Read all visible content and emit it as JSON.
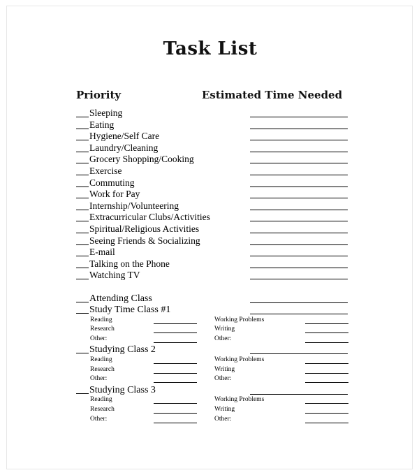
{
  "document": {
    "title": "Task List",
    "headers": {
      "priority": "Priority",
      "estimated_time": "Estimated Time Needed"
    },
    "blank_prefix": "___"
  },
  "tasks": [
    {
      "label": "Sleeping",
      "has_time_line": true
    },
    {
      "label": "Eating",
      "has_time_line": true
    },
    {
      "label": "Hygiene/Self Care",
      "has_time_line": true
    },
    {
      "label": "Laundry/Cleaning",
      "has_time_line": true
    },
    {
      "label": "Grocery Shopping/Cooking",
      "has_time_line": true
    },
    {
      "label": "Exercise",
      "has_time_line": true
    },
    {
      "label": "Commuting",
      "has_time_line": true
    },
    {
      "label": "Work for Pay",
      "has_time_line": true
    },
    {
      "label": "Internship/Volunteering",
      "has_time_line": true
    },
    {
      "label": "Extracurricular Clubs/Activities",
      "has_time_line": true
    },
    {
      "label": "Spiritual/Religious Activities",
      "has_time_line": true
    },
    {
      "label": "Seeing Friends & Socializing",
      "has_time_line": true
    },
    {
      "label": "E-mail",
      "has_time_line": true
    },
    {
      "label": "Talking on the Phone",
      "has_time_line": true
    },
    {
      "label": "Watching TV",
      "has_time_line": true
    }
  ],
  "class_section": {
    "attending": {
      "label": "Attending Class",
      "has_time_line": true
    },
    "classes": [
      {
        "label": "Study Time Class #1",
        "has_time_line": true,
        "subrows": [
          {
            "left_label": "Reading",
            "right_label": "Working Problems"
          },
          {
            "left_label": "Research",
            "right_label": "Writing"
          },
          {
            "left_label": "Other:",
            "right_label": "Other:"
          }
        ]
      },
      {
        "label": "Studying Class 2",
        "has_time_line": true,
        "subrows": [
          {
            "left_label": "Reading",
            "right_label": "Working Problems"
          },
          {
            "left_label": "Research",
            "right_label": "Writing"
          },
          {
            "left_label": "Other:",
            "right_label": "Other:"
          }
        ]
      },
      {
        "label": "Studying Class 3",
        "has_time_line": true,
        "subrows": [
          {
            "left_label": "Reading",
            "right_label": "Working Problems"
          },
          {
            "left_label": "Research",
            "right_label": "Writing"
          },
          {
            "left_label": "Other:",
            "right_label": "Other:"
          }
        ]
      }
    ]
  },
  "colors": {
    "text": "#000000",
    "page_border": "#e6e6e6",
    "rule": "#000000",
    "background": "#ffffff"
  }
}
